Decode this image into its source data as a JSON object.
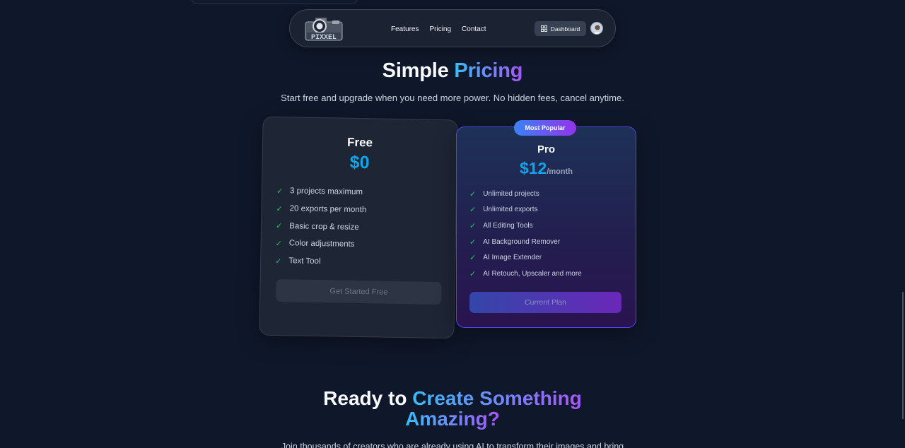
{
  "navbar": {
    "logo_text": "PIXXEL",
    "links": [
      "Features",
      "Pricing",
      "Contact"
    ],
    "dashboard_label": "Dashboard"
  },
  "hero": {
    "title_plain": "Simple",
    "title_accent": "Pricing",
    "subtitle": "Start free and upgrade when you need more power. No hidden fees, cancel anytime."
  },
  "plans": {
    "free": {
      "name": "Free",
      "price": "$0",
      "features": [
        "3 projects maximum",
        "20 exports per month",
        "Basic crop & resize",
        "Color adjustments",
        "Text Tool"
      ],
      "button": "Get Started Free"
    },
    "pro": {
      "badge": "Most Popular",
      "name": "Pro",
      "price": "$12",
      "period": "/month",
      "features": [
        "Unlimited projects",
        "Unlimited exports",
        "All Editing Tools",
        "AI Background Remover",
        "AI Image Extender",
        "AI Retouch, Upscaler and more"
      ],
      "button": "Current Plan"
    }
  },
  "cta": {
    "title_plain": "Ready to",
    "title_accent_line1": "Create Something",
    "title_accent_line2": "Amazing?",
    "subtitle": "Join thousands of creators who are already using AI to transform their images and bring"
  },
  "check_symbol": "✓",
  "colors": {
    "background": "#0f172a",
    "accent_blue": "#0ea5e9",
    "accent_purple": "#a855f7",
    "check_green": "#22c55e"
  }
}
